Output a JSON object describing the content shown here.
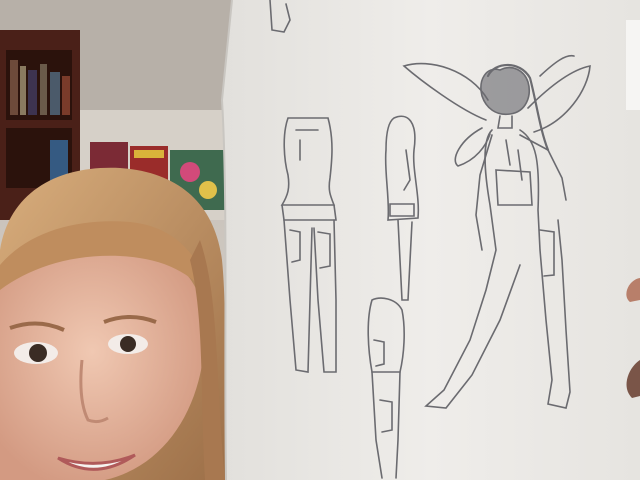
{
  "photo": {
    "description_hidden": "",
    "poster_text": "",
    "colors": {
      "wall": "#d8d2cb",
      "ceiling": "#c9c3bc",
      "shelf": "#5a2a1e",
      "paper": "#eceae6",
      "hair": "#c79a6b",
      "skin": "#e8b9a2",
      "pencil": "#6b6b70"
    }
  }
}
